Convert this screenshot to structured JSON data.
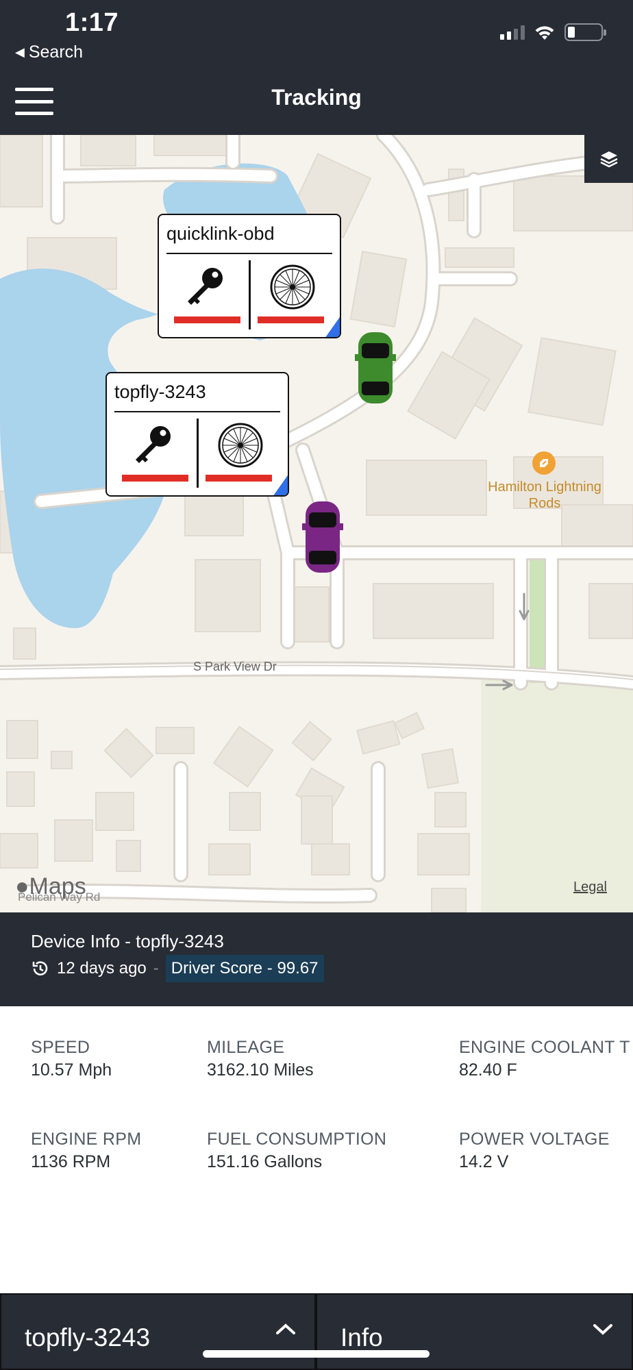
{
  "status_bar": {
    "time": "1:17",
    "back_label": "Search",
    "icons": [
      "cellular-signal-icon",
      "wifi-icon",
      "battery-low-icon"
    ]
  },
  "header": {
    "title": "Tracking",
    "menu_icon": "hamburger-menu-icon"
  },
  "map": {
    "layers_icon": "layers-icon",
    "devices": [
      {
        "name": "quicklink-obd",
        "ignition_icon": "key-icon",
        "wheel_icon": "wheel-icon",
        "status_color": "#e02e26",
        "corner_color": "#2f6fe8"
      },
      {
        "name": "topfly-3243",
        "ignition_icon": "key-icon",
        "wheel_icon": "wheel-icon",
        "status_color": "#e02e26",
        "corner_color": "#2f6fe8"
      }
    ],
    "vehicles": [
      {
        "icon": "car-icon",
        "color": "#3d8b2c"
      },
      {
        "icon": "car-icon",
        "color": "#7a2684"
      }
    ],
    "poi": {
      "name": "Hamilton Lightning Rods",
      "icon": "business-pin-icon"
    },
    "street_labels": [
      "S Park View Dr",
      "Pelican Way Rd"
    ],
    "attribution": "Maps",
    "legal": "Legal"
  },
  "device_info": {
    "title": "Device Info - topfly-3243",
    "last_seen": "12 days ago",
    "separator": "-",
    "driver_score": "Driver Score - 99.67",
    "history_icon": "history-icon"
  },
  "metrics": [
    {
      "label": "SPEED",
      "value": "10.57 Mph"
    },
    {
      "label": "MILEAGE",
      "value": "3162.10 Miles"
    },
    {
      "label": "ENGINE COOLANT T",
      "value": "82.40 F"
    },
    {
      "label": "ENGINE RPM",
      "value": "1136 RPM"
    },
    {
      "label": "FUEL CONSUMPTION",
      "value": "151.16 Gallons"
    },
    {
      "label": "POWER VOLTAGE",
      "value": "14.2 V"
    }
  ],
  "bottom_bar": {
    "device_selector": "topfly-3243",
    "view_selector": "Info",
    "device_chevron_icon": "chevron-up-icon",
    "view_chevron_icon": "chevron-down-icon"
  },
  "colors": {
    "header_bg": "#272c35",
    "status_red": "#e02e26",
    "corner_blue": "#2f6fe8",
    "score_bg": "#1b3d55",
    "water": "#aad3ec"
  }
}
